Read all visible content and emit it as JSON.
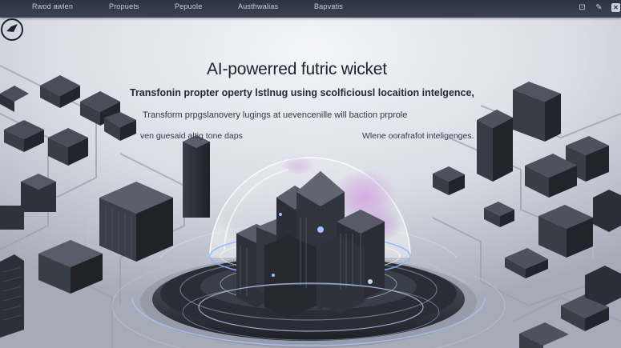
{
  "nav": {
    "items": [
      {
        "label": "Rwod awlen"
      },
      {
        "label": "Propuets"
      },
      {
        "label": "Pepuole"
      },
      {
        "label": "Austhwalias"
      },
      {
        "label": "Bapvatis"
      }
    ]
  },
  "window_controls": {
    "menu_glyph": "⊡",
    "pin_glyph": "✎",
    "close_glyph": "✕"
  },
  "hero": {
    "title": "AI-powerred futric wicket",
    "subtitle_1": "Transfonin propter operty lstlnug using scolficiousl locaition intelgence,",
    "subtitle_2": "Transform prpgslanovery lugings at uevencenille will baction prprole",
    "subtitle_3": "ven guesaid altig tone daps",
    "subtitle_4": "Wlene oorafrafot inteligenges."
  },
  "colors": {
    "nav_bg": "#2c3344",
    "scene_bg": "#dfe1e8",
    "building_dark": "#2b2e36",
    "dome_accent": "#8fb4ff",
    "blossom": "#c79ad8"
  }
}
